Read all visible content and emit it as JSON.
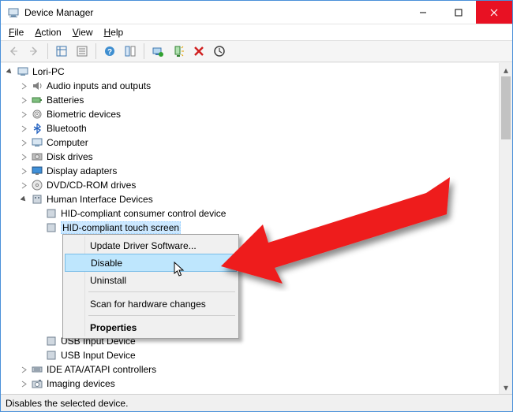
{
  "titlebar": {
    "title": "Device Manager"
  },
  "menubar": {
    "file": "File",
    "action": "Action",
    "view": "View",
    "help": "Help"
  },
  "tree": {
    "root": "Lori-PC",
    "cat_audio": "Audio inputs and outputs",
    "cat_batteries": "Batteries",
    "cat_biometric": "Biometric devices",
    "cat_bluetooth": "Bluetooth",
    "cat_computer": "Computer",
    "cat_disk": "Disk drives",
    "cat_display": "Display adapters",
    "cat_dvd": "DVD/CD-ROM drives",
    "cat_hid": "Human Interface Devices",
    "hid_consumer": "HID-compliant consumer control device",
    "hid_touch": "HID-compliant touch screen",
    "hid_usb1": "USB Input Device",
    "hid_usb2": "USB Input Device",
    "cat_ide": "IDE ATA/ATAPI controllers",
    "cat_imaging": "Imaging devices"
  },
  "contextmenu": {
    "update": "Update Driver Software...",
    "disable": "Disable",
    "uninstall": "Uninstall",
    "scan": "Scan for hardware changes",
    "properties": "Properties"
  },
  "statusbar": {
    "text": "Disables the selected device."
  }
}
